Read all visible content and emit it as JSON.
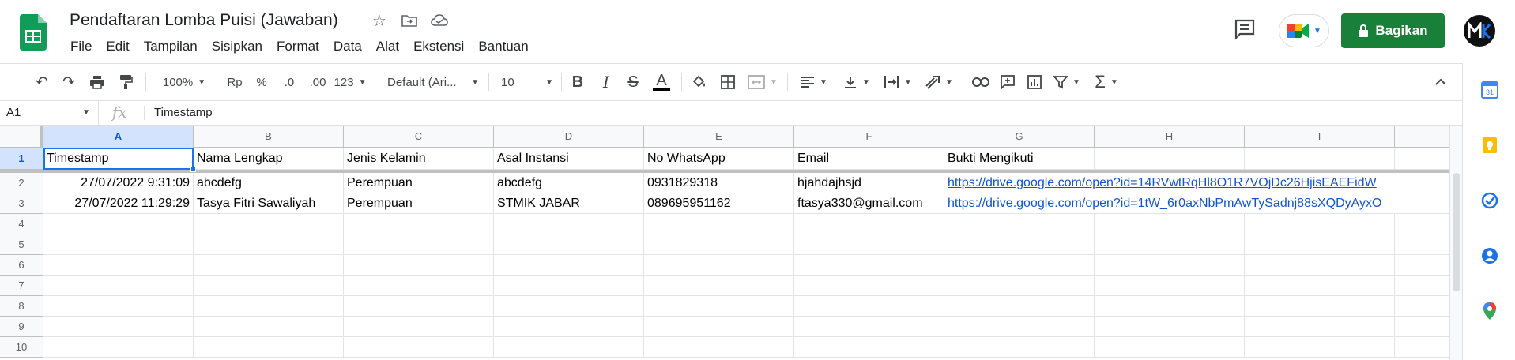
{
  "app": {
    "doc_title": "Pendaftaran Lomba Puisi (Jawaban)",
    "menu": [
      "File",
      "Edit",
      "Tampilan",
      "Sisipkan",
      "Format",
      "Data",
      "Alat",
      "Ekstensi",
      "Bantuan"
    ],
    "share_label": "Bagikan",
    "accent_color": "#188038"
  },
  "toolbar": {
    "zoom": "100%",
    "currency": "Rp",
    "percent": "%",
    "decrease_decimal": ".0",
    "increase_decimal": ".00",
    "number_format": "123",
    "font": "Default (Ari...",
    "font_size": "10",
    "bold": "B",
    "italic": "I",
    "strike": "S",
    "text_color": "A"
  },
  "formula_bar": {
    "cell_ref": "A1",
    "fx": "fx",
    "value": "Timestamp"
  },
  "grid": {
    "columns": [
      "A",
      "B",
      "C",
      "D",
      "E",
      "F",
      "G",
      "H",
      "I"
    ],
    "rows": [
      "1",
      "2",
      "3",
      "4",
      "5",
      "6",
      "7",
      "8",
      "9",
      "10"
    ],
    "header_row": [
      "Timestamp",
      "Nama Lengkap",
      "Jenis Kelamin",
      "Asal Instansi",
      "No WhatsApp",
      "Email",
      "Bukti Mengikuti"
    ],
    "data_rows": [
      [
        "27/07/2022 9:31:09",
        "abcdefg",
        "Perempuan",
        "abcdefg",
        "0931829318",
        "hjahdajhsjd",
        "https://drive.google.com/open?id=14RVwtRqHl8O1R7VOjDc26HjisEAEFidW"
      ],
      [
        "27/07/2022 11:29:29",
        "Tasya Fitri Sawaliyah",
        "Perempuan",
        "STMIK JABAR",
        "089695951162",
        "ftasya330@gmail.com",
        "https://drive.google.com/open?id=1tW_6r0axNbPmAwTySadnj88sXQDyAyxO"
      ]
    ]
  },
  "avatar_text": "MIK"
}
